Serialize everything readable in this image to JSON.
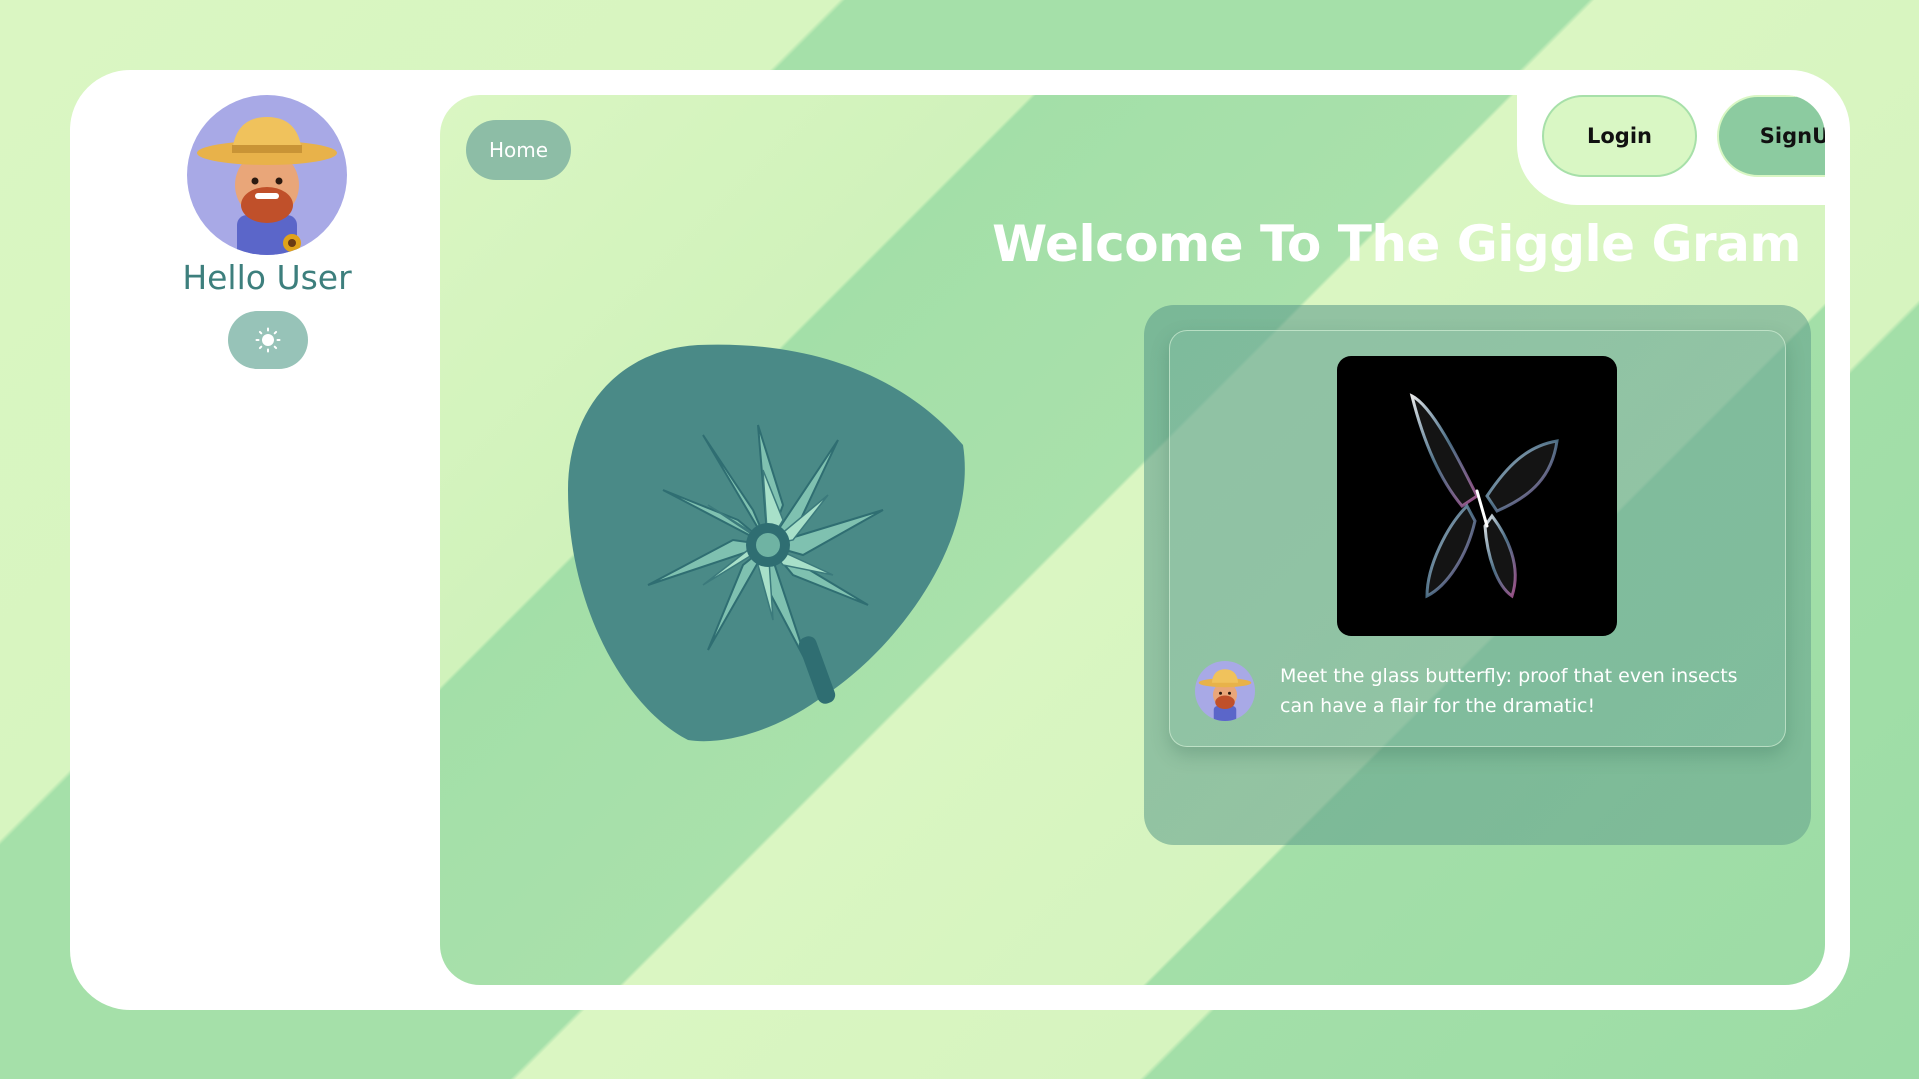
{
  "sidebar": {
    "greeting": "Hello User",
    "avatar_icon": "farmer-avatar-icon",
    "theme_toggle_icon": "sun-icon"
  },
  "nav": {
    "home_label": "Home",
    "login_label": "Login",
    "signup_label": "SignUp"
  },
  "main": {
    "title": "Welcome To The Giggle Gram",
    "hero_image": "iridescent-flower-image"
  },
  "feed": {
    "posts": [
      {
        "image": "glass-butterfly-image",
        "author_avatar": "farmer-avatar-icon",
        "caption": "Meet the glass butterfly: proof that even insects can have a flair for the dramatic!"
      }
    ]
  },
  "colors": {
    "background_light": "#daf6c2",
    "background_mid": "#a5e0a9",
    "panel_white": "#ffffff",
    "accent_teal": "#3d7f7d",
    "home_button": "#8dbda6",
    "login_button": "#d9f7c4",
    "signup_button": "#8ccba0",
    "blob": "#4a8a87"
  }
}
